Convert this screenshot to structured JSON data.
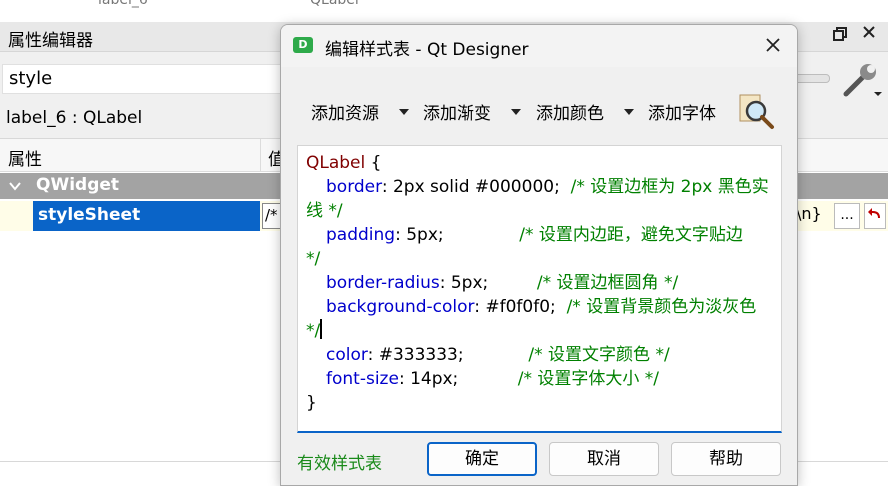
{
  "background": {
    "ghost_left": "label_6",
    "ghost_right": "QLabel",
    "panel_title": "属性编辑器",
    "filter_value": "style",
    "object_label": "label_6 : QLabel",
    "header_property": "属性",
    "header_value": "值",
    "group_label": "QWidget",
    "row_name": "styleSheet",
    "row_value_preview": "/*",
    "row_value_tail": "\\n}",
    "dots_label": "..."
  },
  "dialog": {
    "title": "编辑样式表 - Qt Designer",
    "app_icon_letter": "D",
    "toolbar": {
      "add_resource": "添加资源",
      "add_gradient": "添加渐变",
      "add_color": "添加颜色",
      "add_font": "添加字体"
    },
    "code": {
      "line1_selector": "QLabel",
      "line1_brace": " {",
      "l2_prop": "border",
      "l2_value": ": 2px solid #000000;  ",
      "l2_comment": "/* 设置边框为 2px 黑色实",
      "l3_comment": "线 */",
      "l4_prop": "padding",
      "l4_value": ": 5px;              ",
      "l4_comment": "/* 设置内边距，避免文字贴边",
      "l5_comment": "*/",
      "l6_prop": "border-radius",
      "l6_value": ": 5px;         ",
      "l6_comment": "/* 设置边框圆角 */",
      "l7_prop": "background-color",
      "l7_value": ": #f0f0f0;  ",
      "l7_comment": "/* 设置背景颜色为淡灰色",
      "l8_comment": "*/",
      "l9_prop": "color",
      "l9_value": ": #333333;            ",
      "l9_comment": "/* 设置文字颜色 */",
      "l10_prop": "font-size",
      "l10_value": ": 14px;           ",
      "l10_comment": "/* 设置字体大小 */",
      "l11_brace": "}"
    },
    "status": "有效样式表",
    "ok_label": "确定",
    "cancel_label": "取消",
    "help_label": "帮助"
  },
  "colors": {
    "selection_blue": "#0a64c8",
    "group_gray": "#a3a3a3",
    "comment_green": "#008000",
    "property_blue": "#0000cc",
    "selector_maroon": "#800000",
    "valid_green": "#1a8a1a"
  },
  "icons": {
    "app": "designer-app-icon",
    "close": "close-icon",
    "float": "float-window-icon",
    "wrench": "wrench-icon",
    "font_search": "magnifier-document-icon",
    "chevron": "chevron-down-icon",
    "reset": "reset-arrow-icon"
  }
}
